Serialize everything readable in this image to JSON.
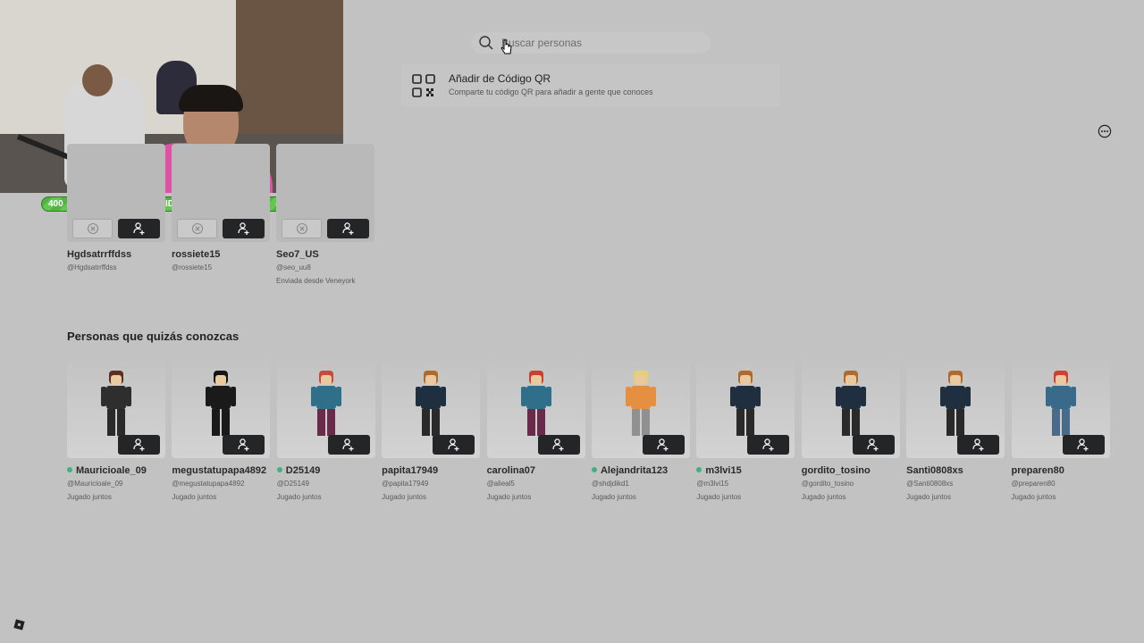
{
  "search": {
    "placeholder": "Buscar personas"
  },
  "qr": {
    "title": "Añadir de Código QR",
    "subtitle": "Comparte tu código QR para añadir a gente que conoces"
  },
  "overlay": {
    "left_count": "400",
    "label": "SEGUIDORES",
    "right_count": "400",
    "progress": 1.0
  },
  "requests": [
    {
      "name": "Hgdsatrrffdss",
      "handle": "@Hgdsatrrffdss",
      "sub": ""
    },
    {
      "name": "rossiete15",
      "handle": "@rossiete15",
      "sub": ""
    },
    {
      "name": "Seo7_US",
      "handle": "@seo_uu8",
      "sub": "Enviada desde Veneyork"
    }
  ],
  "suggestions": {
    "title": "Personas que quizás conozcas",
    "people": [
      {
        "name": "Mauricioale_09",
        "handle": "@Mauricioale_09",
        "sub": "Jugado juntos",
        "online": true,
        "hair": "#5a2e22",
        "shirt": "#2e2e2e",
        "pants": "#2a2a2a"
      },
      {
        "name": "megustatupapa4892",
        "handle": "@megustatupapa4892",
        "sub": "Jugado juntos",
        "online": false,
        "hair": "#151515",
        "shirt": "#1a1a1a",
        "pants": "#1a1a1a"
      },
      {
        "name": "D25149",
        "handle": "@D25149",
        "sub": "Jugado juntos",
        "online": true,
        "hair": "#c94a3a",
        "shirt": "#2f6f8a",
        "pants": "#6a2a4a"
      },
      {
        "name": "papita17949",
        "handle": "@papita17949",
        "sub": "Jugado juntos",
        "online": false,
        "hair": "#b06a2c",
        "shirt": "#1f2f3f",
        "pants": "#2a2a2a"
      },
      {
        "name": "carolina07",
        "handle": "@alieal5",
        "sub": "Jugado juntos",
        "online": false,
        "hair": "#c84030",
        "shirt": "#2f6f8a",
        "pants": "#6a2a4a"
      },
      {
        "name": "Alejandrita123",
        "handle": "@shdjdikd1",
        "sub": "Jugado juntos",
        "online": true,
        "hair": "#e8d070",
        "shirt": "#e59040",
        "pants": "#909090"
      },
      {
        "name": "m3lvi15",
        "handle": "@m3lvi15",
        "sub": "Jugado juntos",
        "online": true,
        "hair": "#b06a2c",
        "shirt": "#1f2f3f",
        "pants": "#2a2a2a"
      },
      {
        "name": "gordito_tosino",
        "handle": "@gordito_tosino",
        "sub": "Jugado juntos",
        "online": false,
        "hair": "#b06a2c",
        "shirt": "#1f2f3f",
        "pants": "#2a2a2a"
      },
      {
        "name": "Santi0808xs",
        "handle": "@Santi0808xs",
        "sub": "Jugado juntos",
        "online": false,
        "hair": "#b06a2c",
        "shirt": "#1f2f3f",
        "pants": "#2a2a2a"
      },
      {
        "name": "preparen80",
        "handle": "@preparen80",
        "sub": "Jugado juntos",
        "online": false,
        "hair": "#d04030",
        "shirt": "#3a6a8a",
        "pants": "#4a6a8a"
      }
    ]
  },
  "colors": {
    "background": "#c2c2c2",
    "button_dark": "#232527",
    "online": "#3fb27f",
    "progress_green": "#52b443"
  },
  "icons": {
    "search": "search-icon",
    "qr": "qr-code-icon",
    "more": "more-options-icon",
    "add_friend": "add-friend-icon",
    "decline": "decline-icon",
    "logo": "roblox-logo-icon"
  }
}
